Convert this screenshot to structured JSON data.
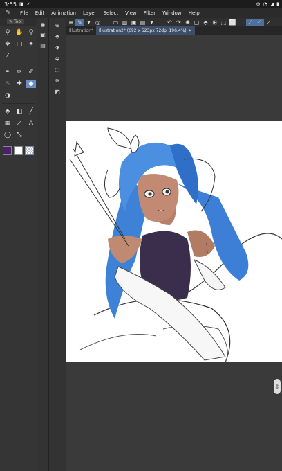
{
  "status": {
    "time": "3:55"
  },
  "menu": [
    "File",
    "Edit",
    "Animation",
    "Layer",
    "Select",
    "View",
    "Filter",
    "Window",
    "Help"
  ],
  "tool_panel": {
    "tab_label": "Tool"
  },
  "tabs": [
    {
      "label": "Illustration*"
    },
    {
      "label": "Illustration2* (692 x 523px 72dpi 196.4%)"
    }
  ],
  "colors": {
    "main": "#4a1f6b",
    "sub": "#ffffff",
    "accent": "#6a8dc4"
  }
}
